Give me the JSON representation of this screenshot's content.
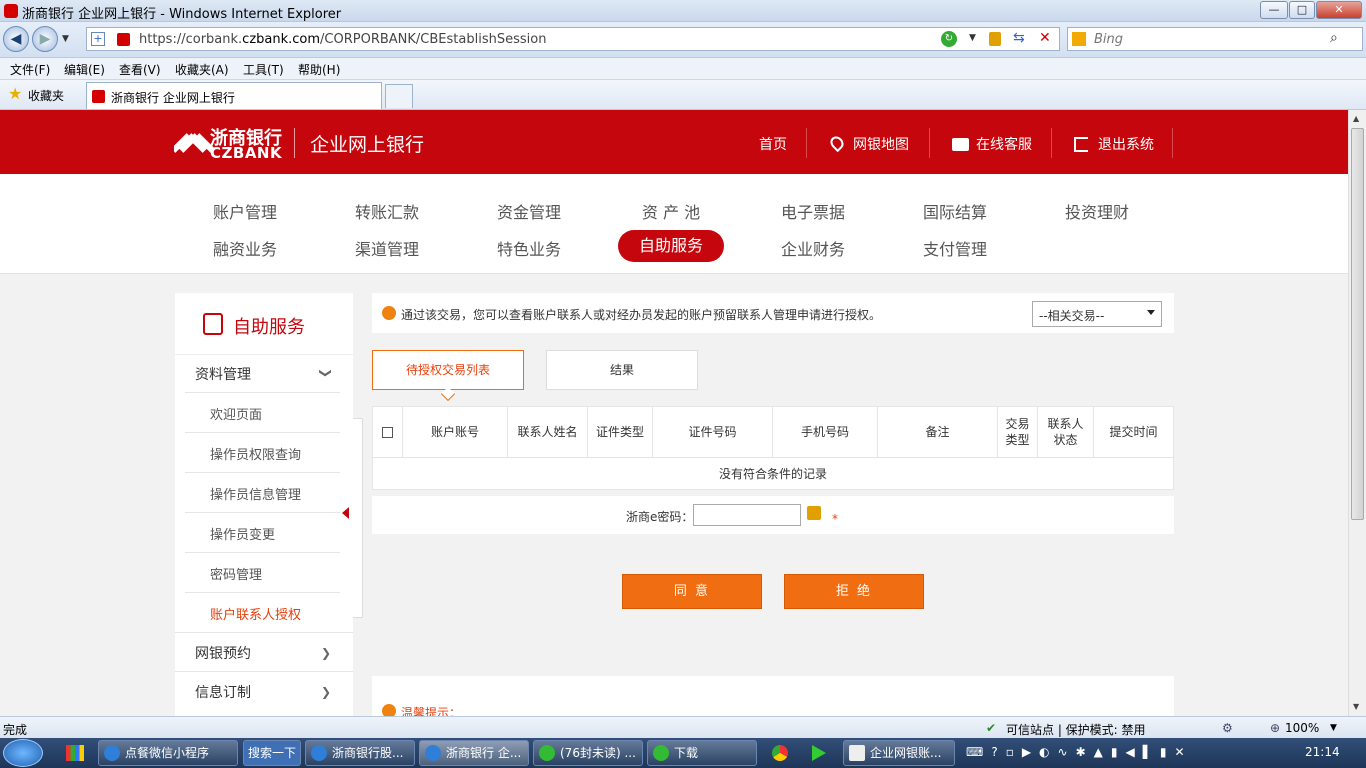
{
  "window": {
    "title": "浙商银行 企业网上银行 - Windows Internet Explorer",
    "controls": {
      "minimize": "—",
      "maximize": "□",
      "close": "✕"
    }
  },
  "addressbar": {
    "url_prefix": "https://corbank.",
    "url_domain": "czbank.com",
    "url_path": "/CORPORBANK/CBEstablishSession",
    "search_placeholder": "Bing"
  },
  "menubar": [
    "文件(F)",
    "编辑(E)",
    "查看(V)",
    "收藏夹(A)",
    "工具(T)",
    "帮助(H)"
  ],
  "favorites": {
    "label": "收藏夹",
    "tab_title": "浙商银行 企业网上银行"
  },
  "bank_header": {
    "logo_cn": "浙商银行",
    "logo_en": "CZBANK",
    "subtitle": "企业网上银行",
    "links": [
      "首页",
      "网银地图",
      "在线客服",
      "退出系统"
    ]
  },
  "main_nav": {
    "row1": [
      "账户管理",
      "转账汇款",
      "资金管理",
      "资 产 池",
      "电子票据",
      "国际结算",
      "投资理财"
    ],
    "row2": [
      "融资业务",
      "渠道管理",
      "特色业务",
      "自助服务",
      "企业财务",
      "支付管理"
    ],
    "active": "自助服务"
  },
  "sidebar": {
    "title": "自助服务",
    "group1": "资料管理",
    "items": [
      "欢迎页面",
      "操作员权限查询",
      "操作员信息管理",
      "操作员变更",
      "密码管理",
      "账户联系人授权"
    ],
    "active_item": "账户联系人授权",
    "group2": "网银预约",
    "group3": "信息订制"
  },
  "content": {
    "info": "通过该交易，您可以查看账户联系人或对经办员发起的账户预留联系人管理申请进行授权。",
    "related_select": "--相关交易--",
    "tabs": [
      "待授权交易列表",
      "结果"
    ],
    "table_headers": [
      "账户账号",
      "联系人姓名",
      "证件类型",
      "证件号码",
      "手机号码",
      "备注",
      "交易类型",
      "联系人状态",
      "提交时间"
    ],
    "no_records": "没有符合条件的记录",
    "password_label": "浙商e密码：",
    "required_mark": "*",
    "agree_button": "同 意",
    "reject_button": "拒 绝",
    "tips_title": "温馨提示："
  },
  "statusbar": {
    "left": "完成",
    "trusted": "可信站点 | 保护模式: 禁用",
    "zoom": "100%"
  },
  "taskbar": {
    "items": [
      "点餐微信小程序",
      "搜索一下",
      "浙商银行股...",
      "浙商银行 企...",
      "(76封未读) ...",
      "下载",
      "企业网银账..."
    ],
    "clock": "21:14"
  }
}
